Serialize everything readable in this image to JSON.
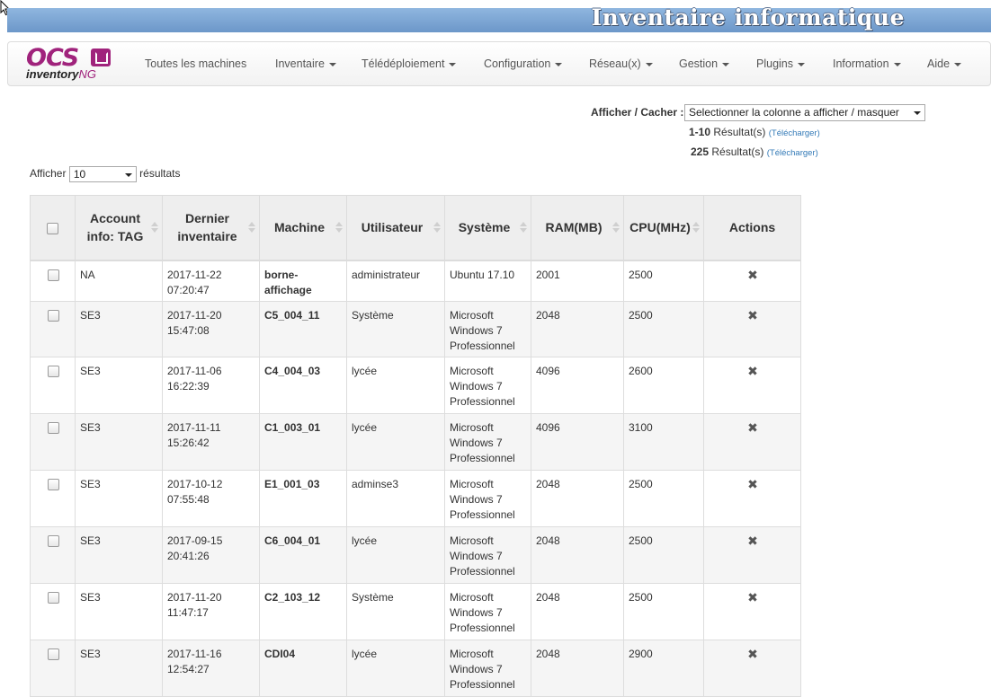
{
  "header": {
    "title": "Inventaire informatique"
  },
  "logo": {
    "ocs": "OCS",
    "inventory": "inventory",
    "ng": "NG"
  },
  "nav": [
    {
      "label": "Toutes les machines",
      "dropdown": false
    },
    {
      "label": "Inventaire",
      "dropdown": true
    },
    {
      "label": "Télédéploiement",
      "dropdown": true
    },
    {
      "label": "Configuration",
      "dropdown": true
    },
    {
      "label": "Réseau(x)",
      "dropdown": true
    },
    {
      "label": "Gestion",
      "dropdown": true
    },
    {
      "label": "Plugins",
      "dropdown": true
    },
    {
      "label": "Information",
      "dropdown": true
    },
    {
      "label": "Aide",
      "dropdown": true
    }
  ],
  "column_toggle": {
    "label": "Afficher / Cacher :",
    "selected": "Selectionner la colonne a afficher / masquer"
  },
  "results": [
    {
      "count": "1-10",
      "text": "Résultat(s)",
      "link": "(Télécharger)"
    },
    {
      "count": "225",
      "text": "Résultat(s)",
      "link": "(Télécharger)"
    }
  ],
  "page_length": {
    "prefix": "Afficher",
    "value": "10",
    "suffix": "résultats"
  },
  "table": {
    "headers": [
      "Account info: TAG",
      "Dernier inventaire",
      "Machine",
      "Utilisateur",
      "Système",
      "RAM(MB)",
      "CPU(MHz)",
      "Actions"
    ],
    "rows": [
      {
        "tag": "NA",
        "date": "2017-11-22 07:20:47",
        "machine": "borne-affichage",
        "user": "administrateur",
        "os": "Ubuntu 17.10",
        "ram": "2001",
        "cpu": "2500"
      },
      {
        "tag": "SE3",
        "date": "2017-11-20 15:47:08",
        "machine": "C5_004_11",
        "user": "Système",
        "os": "Microsoft Windows 7 Professionnel",
        "ram": "2048",
        "cpu": "2500"
      },
      {
        "tag": "SE3",
        "date": "2017-11-06 16:22:39",
        "machine": "C4_004_03",
        "user": "lycée",
        "os": "Microsoft Windows 7 Professionnel",
        "ram": "4096",
        "cpu": "2600"
      },
      {
        "tag": "SE3",
        "date": "2017-11-11 15:26:42",
        "machine": "C1_003_01",
        "user": "lycée",
        "os": "Microsoft Windows 7 Professionnel",
        "ram": "4096",
        "cpu": "3100"
      },
      {
        "tag": "SE3",
        "date": "2017-10-12 07:55:48",
        "machine": "E1_001_03",
        "user": "adminse3",
        "os": "Microsoft Windows 7 Professionnel",
        "ram": "2048",
        "cpu": "2500"
      },
      {
        "tag": "SE3",
        "date": "2017-09-15 20:41:26",
        "machine": "C6_004_01",
        "user": "lycée",
        "os": "Microsoft Windows 7 Professionnel",
        "ram": "2048",
        "cpu": "2500"
      },
      {
        "tag": "SE3",
        "date": "2017-11-20 11:47:17",
        "machine": "C2_103_12",
        "user": "Système",
        "os": "Microsoft Windows 7 Professionnel",
        "ram": "2048",
        "cpu": "2500"
      },
      {
        "tag": "SE3",
        "date": "2017-11-16 12:54:27",
        "machine": "CDI04",
        "user": "lycée",
        "os": "Microsoft Windows 7 Professionnel",
        "ram": "2048",
        "cpu": "2900"
      }
    ],
    "action_icon": "delete-icon"
  }
}
